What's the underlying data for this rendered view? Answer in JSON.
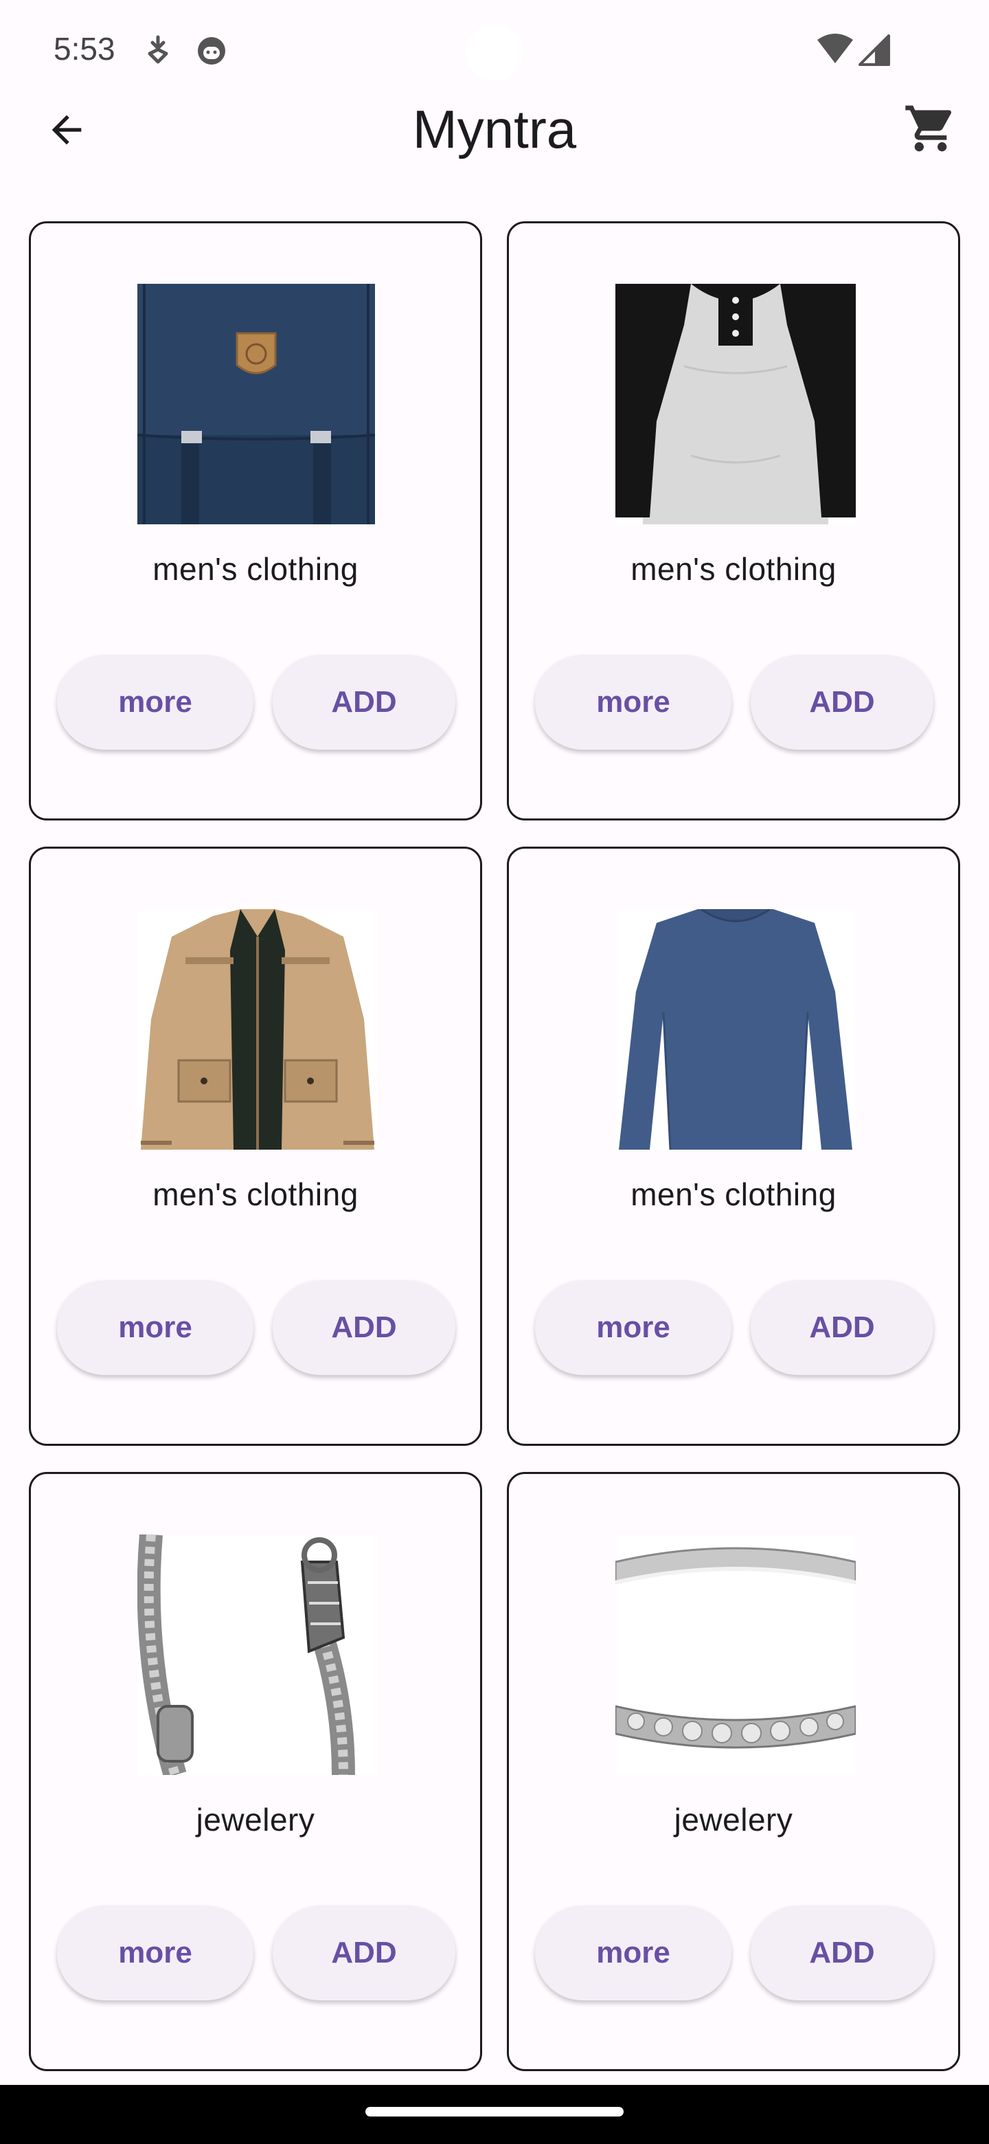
{
  "status_bar": {
    "time": "5:53",
    "icons": [
      "download-icon",
      "face-icon",
      "wifi-icon",
      "signal-icon"
    ]
  },
  "app_bar": {
    "title": "Myntra",
    "back_icon": "arrow-left-icon",
    "cart_icon": "shopping-cart-icon"
  },
  "products": [
    {
      "category": "men's clothing",
      "image": "backpack",
      "more_label": "more",
      "add_label": "ADD"
    },
    {
      "category": "men's clothing",
      "image": "raglan-tshirt",
      "more_label": "more",
      "add_label": "ADD"
    },
    {
      "category": "men's clothing",
      "image": "jacket",
      "more_label": "more",
      "add_label": "ADD"
    },
    {
      "category": "men's clothing",
      "image": "long-sleeve-shirt",
      "more_label": "more",
      "add_label": "ADD"
    },
    {
      "category": "jewelery",
      "image": "chain-bracelet",
      "more_label": "more",
      "add_label": "ADD"
    },
    {
      "category": "jewelery",
      "image": "diamond-ring",
      "more_label": "more",
      "add_label": "ADD"
    }
  ],
  "colors": {
    "background": "#fffbfe",
    "button_bg": "#f4eff7",
    "button_text": "#6750a4",
    "card_border": "#1c1b1f"
  }
}
